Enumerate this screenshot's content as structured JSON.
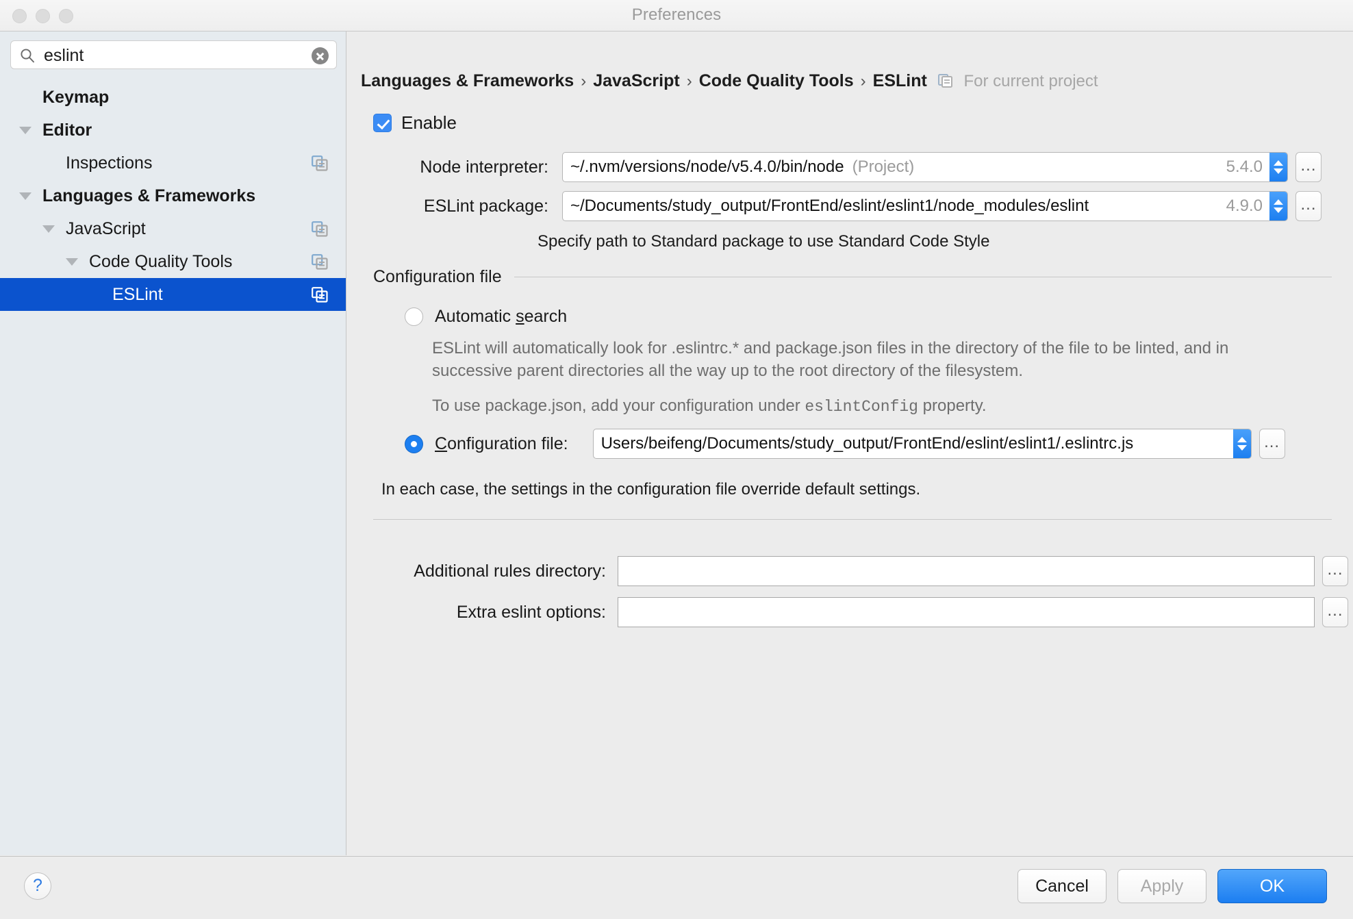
{
  "window": {
    "title": "Preferences"
  },
  "search": {
    "value": "eslint",
    "placeholder": "Search",
    "icon": "search-icon",
    "clear_icon": "clear-icon"
  },
  "sidebar": {
    "items": [
      {
        "label": "Keymap",
        "level": 0,
        "bold": true,
        "twisty": false,
        "selected": false,
        "icon": false
      },
      {
        "label": "Editor",
        "level": 0,
        "bold": true,
        "twisty": true,
        "selected": false,
        "icon": false
      },
      {
        "label": "Inspections",
        "level": 1,
        "bold": false,
        "twisty": false,
        "selected": false,
        "icon": true
      },
      {
        "label": "Languages & Frameworks",
        "level": 0,
        "bold": true,
        "twisty": true,
        "selected": false,
        "icon": false
      },
      {
        "label": "JavaScript",
        "level": 1,
        "bold": false,
        "twisty": true,
        "selected": false,
        "icon": true
      },
      {
        "label": "Code Quality Tools",
        "level": 2,
        "bold": false,
        "twisty": true,
        "selected": false,
        "icon": true
      },
      {
        "label": "ESLint",
        "level": 3,
        "bold": false,
        "twisty": false,
        "selected": true,
        "icon": true
      }
    ],
    "selected_color": "#0b53ce"
  },
  "breadcrumb": {
    "crumbs": [
      "Languages & Frameworks",
      "JavaScript",
      "Code Quality Tools",
      "ESLint"
    ],
    "separator": "›",
    "note": "For current project",
    "note_icon": "project-scope-icon"
  },
  "main": {
    "enable": {
      "label": "Enable",
      "checked": true
    },
    "node_interpreter": {
      "label": "Node interpreter:",
      "value": "~/.nvm/versions/node/v5.4.0/bin/node",
      "suffix": "(Project)",
      "version": "5.4.0",
      "browse_label": "..."
    },
    "eslint_package": {
      "label": "ESLint package:",
      "value": "~/Documents/study_output/FrontEnd/eslint/eslint1/node_modules/eslint",
      "version": "4.9.0",
      "browse_label": "..."
    },
    "package_hint": "Specify path to Standard package to use Standard Code Style",
    "config_group": {
      "title": "Configuration file",
      "automatic": {
        "label_pre": "Automatic ",
        "label_mnemonic": "s",
        "label_post": "earch",
        "selected": false,
        "description": "ESLint will automatically look for .eslintrc.* and package.json files in the directory of the file to be linted, and in successive parent directories all the way up to the root directory of the filesystem.",
        "package_json_note_pre": "To use package.json, add your configuration under ",
        "package_json_note_mono": "eslintConfig",
        "package_json_note_post": " property."
      },
      "config_file": {
        "label_mnemonic": "C",
        "label_rest": "onfiguration file:",
        "selected": true,
        "value": "Users/beifeng/Documents/study_output/FrontEnd/eslint/eslint1/.eslintrc.js",
        "browse_label": "..."
      },
      "override_note": "In each case, the settings in the configuration file override default settings."
    },
    "additional_rules": {
      "label": "Additional rules directory:",
      "value": "",
      "placeholder": "",
      "browse_label": "..."
    },
    "extra_options": {
      "label": "Extra eslint options:",
      "value": "",
      "placeholder": "",
      "browse_label": "..."
    }
  },
  "footer": {
    "help_label": "?",
    "cancel_label": "Cancel",
    "apply_label": "Apply",
    "ok_label": "OK"
  }
}
